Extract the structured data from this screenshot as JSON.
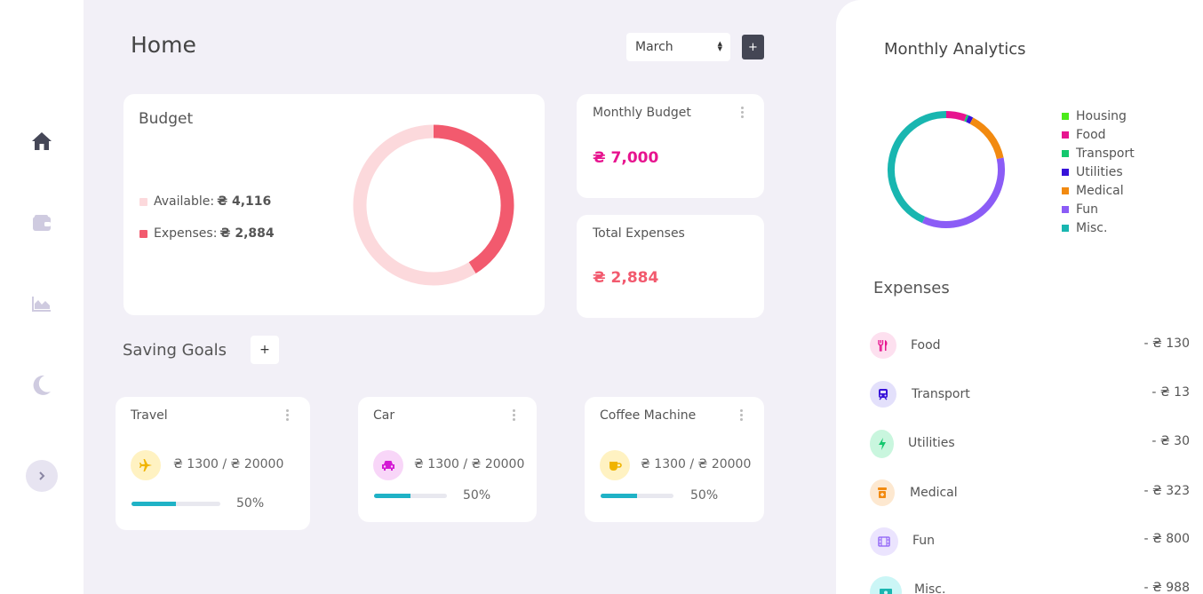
{
  "page": {
    "title": "Home"
  },
  "header": {
    "month": "March",
    "add_label": "+"
  },
  "budget": {
    "title": "Budget",
    "available_label": "Available:",
    "available_value": "₴ 4,116",
    "expenses_label": "Expenses:",
    "expenses_value": "₴ 2,884",
    "available_amount": 4116,
    "expenses_amount": 2884,
    "colors": {
      "available": "#fcd9dc",
      "expenses": "#f25a6e"
    }
  },
  "monthly_budget": {
    "label": "Monthly Budget",
    "value": "₴ 7,000",
    "color": "#e7148f"
  },
  "total_expenses": {
    "label": "Total Expenses",
    "value": "₴ 2,884",
    "color": "#f25a6e"
  },
  "saving_goals": {
    "title": "Saving Goals",
    "add_label": "+",
    "goals": [
      {
        "name": "Travel",
        "icon": "airplane-icon",
        "amount": "₴ 1300 / ₴ 20000",
        "percent_label": "50%",
        "progress": 0.5
      },
      {
        "name": "Car",
        "icon": "car-icon",
        "amount": "₴ 1300 / ₴ 20000",
        "percent_label": "50%",
        "progress": 0.5
      },
      {
        "name": "Coffee Machine",
        "icon": "coffee-icon",
        "amount": "₴ 1300 / ₴ 20000",
        "percent_label": "50%",
        "progress": 0.5
      }
    ]
  },
  "analytics": {
    "title": "Monthly Analytics",
    "legend": [
      {
        "name": "Housing",
        "color": "#4ceb1a",
        "value": 0
      },
      {
        "name": "Food",
        "color": "#e7148f",
        "value": 130
      },
      {
        "name": "Transport",
        "color": "#14c86e",
        "value": 13
      },
      {
        "name": "Utilities",
        "color": "#3712d9",
        "value": 30
      },
      {
        "name": "Medical",
        "color": "#f28a10",
        "value": 323
      },
      {
        "name": "Fun",
        "color": "#8b5cf6",
        "value": 800
      },
      {
        "name": "Misc.",
        "color": "#19b6b0",
        "value": 988
      }
    ]
  },
  "expenses": {
    "title": "Expenses",
    "items": [
      {
        "name": "Food",
        "amount": "- ₴ 130",
        "icon": "utensils-icon",
        "bg": "#fde0ef",
        "fg": "#e7148f"
      },
      {
        "name": "Transport",
        "amount": "- ₴ 13",
        "icon": "train-icon",
        "bg": "#e3e0fb",
        "fg": "#3712d9"
      },
      {
        "name": "Utilities",
        "amount": "- ₴ 30",
        "icon": "bolt-icon",
        "bg": "#c9f6de",
        "fg": "#14c86e"
      },
      {
        "name": "Medical",
        "amount": "- ₴ 323",
        "icon": "pill-bottle-icon",
        "bg": "#fde8d0",
        "fg": "#f28a10"
      },
      {
        "name": "Fun",
        "amount": "- ₴ 800",
        "icon": "film-icon",
        "bg": "#ebe4fe",
        "fg": "#8b5cf6"
      },
      {
        "name": "Misc.",
        "amount": "- ₴ 988",
        "icon": "money-icon",
        "bg": "#cbf6f6",
        "fg": "#19b6b0"
      }
    ]
  }
}
